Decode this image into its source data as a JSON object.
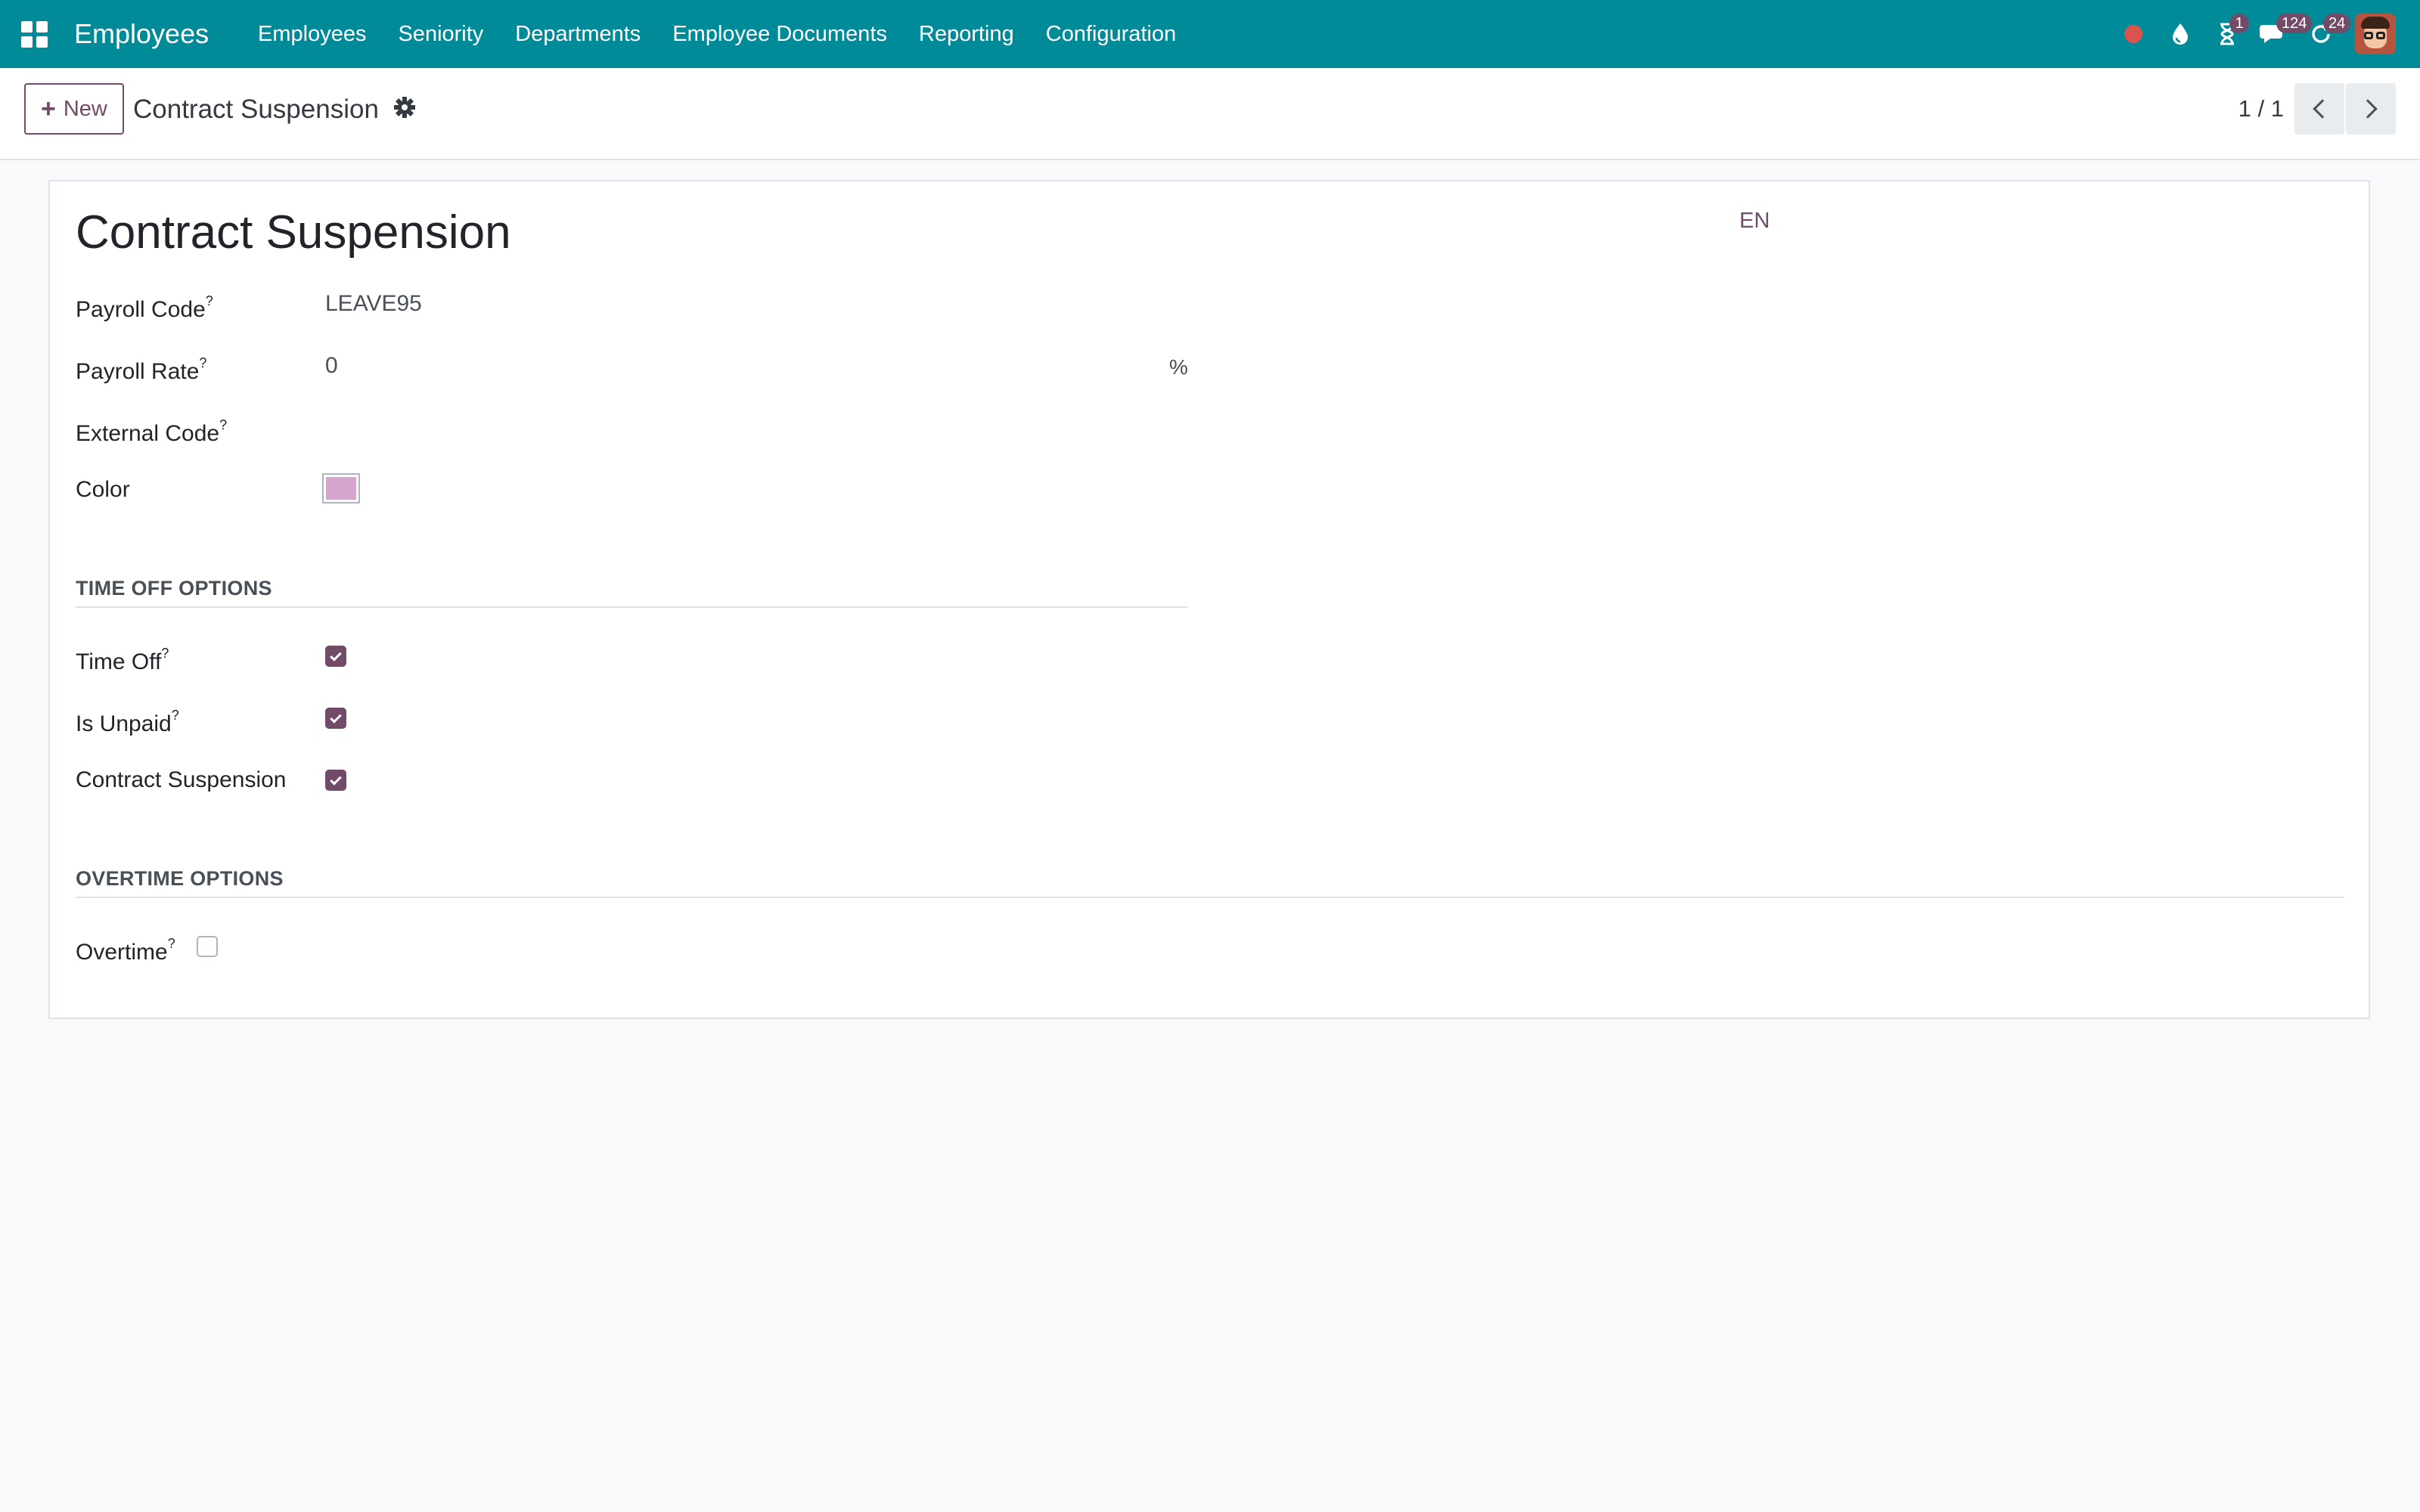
{
  "navbar": {
    "app_name": "Employees",
    "menu": [
      "Employees",
      "Seniority",
      "Departments",
      "Employee Documents",
      "Reporting",
      "Configuration"
    ],
    "badges": {
      "activities": "1",
      "messages": "124",
      "updates": "24"
    },
    "icons": [
      "record-icon",
      "drop-icon",
      "hourglass-icon",
      "chat-icon",
      "refresh-icon"
    ],
    "accent": "#018b98"
  },
  "control_panel": {
    "new_label": "New",
    "breadcrumb": "Contract Suspension",
    "pager": "1 / 1"
  },
  "form": {
    "title": "Contract Suspension",
    "lang": "EN",
    "labels": {
      "payroll_code": "Payroll Code",
      "payroll_rate": "Payroll Rate",
      "external_code": "External Code",
      "color": "Color",
      "time_off": "Time Off",
      "is_unpaid": "Is Unpaid",
      "contract_suspension": "Contract Suspension",
      "overtime": "Overtime"
    },
    "help": "?",
    "values": {
      "payroll_code": "LEAVE95",
      "payroll_rate": "0",
      "payroll_rate_unit": "%",
      "external_code": "",
      "color": "#d8a6cc"
    },
    "sections": {
      "time_off": "TIME OFF OPTIONS",
      "overtime": "OVERTIME OPTIONS"
    },
    "checks": {
      "time_off": true,
      "is_unpaid": true,
      "contract_suspension": true,
      "overtime": false
    }
  }
}
